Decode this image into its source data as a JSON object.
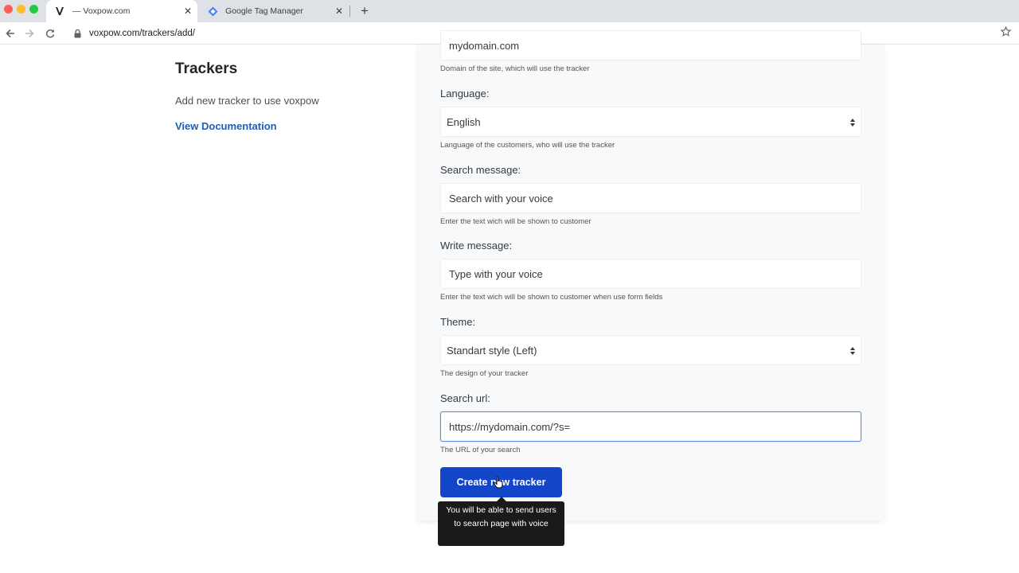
{
  "browser": {
    "tabs": [
      {
        "title": "— Voxpow.com",
        "favicon": "voxpow-v-icon"
      },
      {
        "title": "Google Tag Manager",
        "favicon": "tag-manager-diamond-icon"
      }
    ],
    "url": "voxpow.com/trackers/add/"
  },
  "sidebar": {
    "title": "Trackers",
    "subtitle": "Add new tracker to use voxpow",
    "doc_link": "View Documentation"
  },
  "form": {
    "domain": {
      "value": "mydomain.com",
      "help": "Domain of the site, which will use the tracker"
    },
    "language": {
      "label": "Language:",
      "value": "English",
      "help": "Language of the customers, who will use the tracker"
    },
    "search_message": {
      "label": "Search message:",
      "value": "Search with your voice",
      "help": "Enter the text wich will be shown to customer"
    },
    "write_message": {
      "label": "Write message:",
      "value": "Type with your voice",
      "help": "Enter the text wich will be shown to customer when use form fields"
    },
    "theme": {
      "label": "Theme:",
      "value": "Standart style (Left)",
      "help": "The design of your tracker"
    },
    "search_url": {
      "label": "Search url:",
      "value": "https://mydomain.com/?s=",
      "help": "The URL of your search"
    },
    "submit_label": "Create new tracker",
    "tooltip": "You will be able to send users to search page with voice"
  },
  "colors": {
    "primary_button": "#1345c9",
    "link": "#1d5fb4",
    "tooltip_bg": "#1a1a1a"
  }
}
